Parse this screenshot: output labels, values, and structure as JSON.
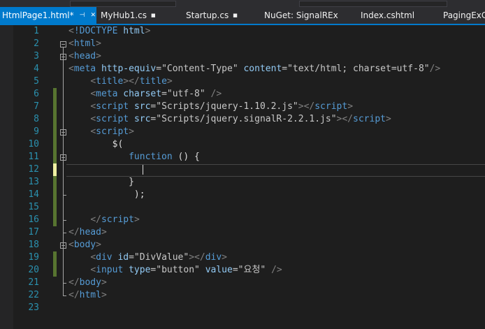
{
  "tabs": [
    {
      "label": "HtmlPage1.html*",
      "active": true,
      "icon": "pin-icon"
    },
    {
      "label": "MyHub1.cs",
      "active": false,
      "icon": "lock-icon"
    },
    {
      "label": "Startup.cs",
      "active": false,
      "icon": "lock-icon"
    },
    {
      "label": "NuGet: SignalREx",
      "active": false,
      "icon": ""
    },
    {
      "label": "Index.cshtml",
      "active": false,
      "icon": ""
    },
    {
      "label": "PagingExCo",
      "active": false,
      "icon": ""
    }
  ],
  "tab_close_glyph": "✕",
  "pin_glyph": "⊣",
  "lock_glyph": "🔒",
  "colors": {
    "accent": "#007acc",
    "line_number": "#2b91af",
    "saved_change": "#577430",
    "unsaved_change": "#efefa2"
  },
  "lines": [
    {
      "n": "1",
      "change": "none",
      "tokens": [
        {
          "t": "<",
          "c": "br"
        },
        {
          "t": "!DOCTYPE",
          "c": "tag"
        },
        {
          "t": " ",
          "c": "plain"
        },
        {
          "t": "html",
          "c": "attr"
        },
        {
          "t": ">",
          "c": "br"
        }
      ]
    },
    {
      "n": "2",
      "change": "none",
      "tokens": [
        {
          "t": "<",
          "c": "br"
        },
        {
          "t": "html",
          "c": "tag"
        },
        {
          "t": ">",
          "c": "br"
        }
      ]
    },
    {
      "n": "3",
      "change": "none",
      "tokens": [
        {
          "t": "<",
          "c": "br"
        },
        {
          "t": "head",
          "c": "tag"
        },
        {
          "t": ">",
          "c": "br"
        }
      ]
    },
    {
      "n": "4",
      "change": "none",
      "tokens": [
        {
          "t": "<",
          "c": "br"
        },
        {
          "t": "meta",
          "c": "tag"
        },
        {
          "t": " ",
          "c": "plain"
        },
        {
          "t": "http-equiv",
          "c": "attr"
        },
        {
          "t": "=\"Content-Type\"",
          "c": "val"
        },
        {
          "t": " ",
          "c": "plain"
        },
        {
          "t": "content",
          "c": "attr"
        },
        {
          "t": "=\"text/html; charset=utf-8\"",
          "c": "val"
        },
        {
          "t": "/>",
          "c": "br"
        }
      ]
    },
    {
      "n": "5",
      "change": "none",
      "tokens": [
        {
          "t": "    ",
          "c": "plain"
        },
        {
          "t": "<",
          "c": "br"
        },
        {
          "t": "title",
          "c": "tag"
        },
        {
          "t": "></",
          "c": "br"
        },
        {
          "t": "title",
          "c": "tag"
        },
        {
          "t": ">",
          "c": "br"
        }
      ]
    },
    {
      "n": "6",
      "change": "saved",
      "tokens": [
        {
          "t": "    ",
          "c": "plain"
        },
        {
          "t": "<",
          "c": "br"
        },
        {
          "t": "meta",
          "c": "tag"
        },
        {
          "t": " ",
          "c": "plain"
        },
        {
          "t": "charset",
          "c": "attr"
        },
        {
          "t": "=\"utf-8\"",
          "c": "val"
        },
        {
          "t": " />",
          "c": "br"
        }
      ]
    },
    {
      "n": "7",
      "change": "saved",
      "tokens": [
        {
          "t": "    ",
          "c": "plain"
        },
        {
          "t": "<",
          "c": "br"
        },
        {
          "t": "script",
          "c": "tag"
        },
        {
          "t": " ",
          "c": "plain"
        },
        {
          "t": "src",
          "c": "attr"
        },
        {
          "t": "=\"Scripts/jquery-1.10.2.js\"",
          "c": "val"
        },
        {
          "t": "></",
          "c": "br"
        },
        {
          "t": "script",
          "c": "tag"
        },
        {
          "t": ">",
          "c": "br"
        }
      ]
    },
    {
      "n": "8",
      "change": "saved",
      "tokens": [
        {
          "t": "    ",
          "c": "plain"
        },
        {
          "t": "<",
          "c": "br"
        },
        {
          "t": "script",
          "c": "tag"
        },
        {
          "t": " ",
          "c": "plain"
        },
        {
          "t": "src",
          "c": "attr"
        },
        {
          "t": "=\"Scripts/jquery.signalR-2.2.1.js\"",
          "c": "val"
        },
        {
          "t": "></",
          "c": "br"
        },
        {
          "t": "script",
          "c": "tag"
        },
        {
          "t": ">",
          "c": "br"
        }
      ]
    },
    {
      "n": "9",
      "change": "saved",
      "tokens": [
        {
          "t": "    ",
          "c": "plain"
        },
        {
          "t": "<",
          "c": "br"
        },
        {
          "t": "script",
          "c": "tag"
        },
        {
          "t": ">",
          "c": "br"
        }
      ]
    },
    {
      "n": "10",
      "change": "saved",
      "tokens": [
        {
          "t": "        $(",
          "c": "txt"
        }
      ]
    },
    {
      "n": "11",
      "change": "saved",
      "tokens": [
        {
          "t": "           ",
          "c": "plain"
        },
        {
          "t": "function",
          "c": "kw"
        },
        {
          "t": " () {",
          "c": "txt"
        }
      ]
    },
    {
      "n": "12",
      "change": "unsaved",
      "tokens": []
    },
    {
      "n": "13",
      "change": "saved",
      "tokens": [
        {
          "t": "           }",
          "c": "txt"
        }
      ]
    },
    {
      "n": "14",
      "change": "saved",
      "tokens": [
        {
          "t": "            );",
          "c": "txt"
        }
      ]
    },
    {
      "n": "15",
      "change": "saved",
      "tokens": []
    },
    {
      "n": "16",
      "change": "saved",
      "tokens": [
        {
          "t": "    ",
          "c": "plain"
        },
        {
          "t": "</",
          "c": "br"
        },
        {
          "t": "script",
          "c": "tag"
        },
        {
          "t": ">",
          "c": "br"
        }
      ]
    },
    {
      "n": "17",
      "change": "none",
      "tokens": [
        {
          "t": "</",
          "c": "br"
        },
        {
          "t": "head",
          "c": "tag"
        },
        {
          "t": ">",
          "c": "br"
        }
      ]
    },
    {
      "n": "18",
      "change": "none",
      "tokens": [
        {
          "t": "<",
          "c": "br"
        },
        {
          "t": "body",
          "c": "tag"
        },
        {
          "t": ">",
          "c": "br"
        }
      ]
    },
    {
      "n": "19",
      "change": "saved",
      "tokens": [
        {
          "t": "    ",
          "c": "plain"
        },
        {
          "t": "<",
          "c": "br"
        },
        {
          "t": "div",
          "c": "tag"
        },
        {
          "t": " ",
          "c": "plain"
        },
        {
          "t": "id",
          "c": "attr"
        },
        {
          "t": "=\"DivValue\"",
          "c": "val"
        },
        {
          "t": "></",
          "c": "br"
        },
        {
          "t": "div",
          "c": "tag"
        },
        {
          "t": ">",
          "c": "br"
        }
      ]
    },
    {
      "n": "20",
      "change": "saved",
      "tokens": [
        {
          "t": "    ",
          "c": "plain"
        },
        {
          "t": "<",
          "c": "br"
        },
        {
          "t": "input",
          "c": "tag"
        },
        {
          "t": " ",
          "c": "plain"
        },
        {
          "t": "type",
          "c": "attr"
        },
        {
          "t": "=\"button\"",
          "c": "val"
        },
        {
          "t": " ",
          "c": "plain"
        },
        {
          "t": "value",
          "c": "attr"
        },
        {
          "t": "=\"요청\"",
          "c": "val"
        },
        {
          "t": " />",
          "c": "br"
        }
      ]
    },
    {
      "n": "21",
      "change": "none",
      "tokens": [
        {
          "t": "</",
          "c": "br"
        },
        {
          "t": "body",
          "c": "tag"
        },
        {
          "t": ">",
          "c": "br"
        }
      ]
    },
    {
      "n": "22",
      "change": "none",
      "tokens": [
        {
          "t": "</",
          "c": "br"
        },
        {
          "t": "html",
          "c": "tag"
        },
        {
          "t": ">",
          "c": "br"
        }
      ]
    },
    {
      "n": "23",
      "change": "none",
      "tokens": []
    }
  ]
}
